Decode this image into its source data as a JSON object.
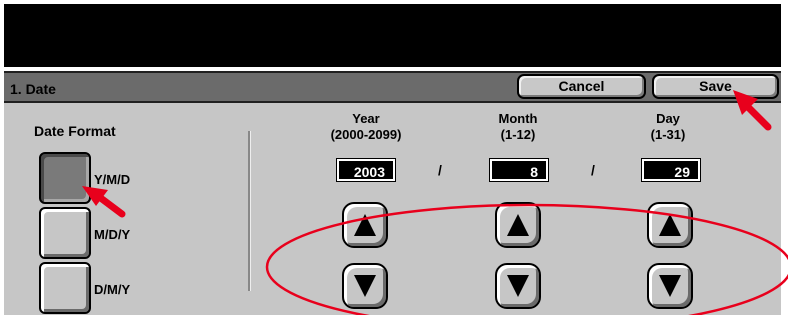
{
  "screen": {
    "title": "1. Date",
    "cancel_label": "Cancel",
    "save_label": "Save"
  },
  "date_format": {
    "heading": "Date Format",
    "options": [
      {
        "label": "Y/M/D",
        "selected": true
      },
      {
        "label": "M/D/Y",
        "selected": false
      },
      {
        "label": "D/M/Y",
        "selected": false
      }
    ]
  },
  "fields": {
    "year": {
      "title": "Year",
      "range": "(2000-2099)",
      "value": "2003"
    },
    "month": {
      "title": "Month",
      "range": "(1-12)",
      "value": "8"
    },
    "day": {
      "title": "Day",
      "range": "(1-31)",
      "value": "29"
    },
    "separator": "/"
  },
  "icons": {
    "up": "up-arrow-icon",
    "down": "down-arrow-icon"
  },
  "annotation_color": "#e8001c"
}
